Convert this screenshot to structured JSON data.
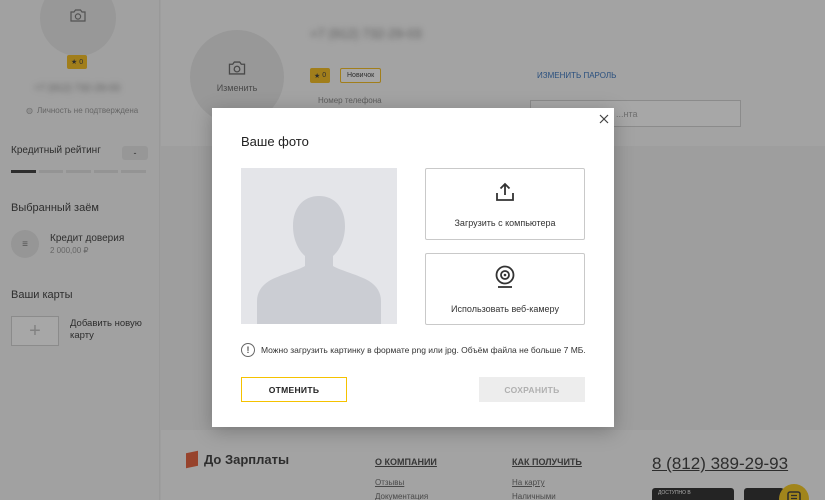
{
  "sidebar": {
    "rating_badge": "0",
    "phone_blurred": "+7 (912) 732-29-03",
    "verification_text": "Личность не подтверждена",
    "credit_rating_title": "Кредитный рейтинг",
    "credit_rating_value": "-",
    "selected_loan_title": "Выбранный заём",
    "loan_name": "Кредит доверия",
    "loan_amount": "2 000,00 ₽",
    "cards_title": "Ваши карты",
    "add_card_label": "Добавить новую карту"
  },
  "profile": {
    "phone_blurred": "+7 (912) 732-29-03",
    "change_photo": "Изменить",
    "rating_badge": "0",
    "status_badge": "Новичок",
    "change_password": "ИЗМЕНИТЬ ПАРОЛЬ",
    "phone_field_label": "Номер телефона",
    "field_placeholder": "...нта"
  },
  "modal": {
    "title": "Ваше фото",
    "upload_label": "Загрузить с компьютера",
    "webcam_label": "Использовать веб-камеру",
    "hint": "Можно загрузить картинку в формате png или jpg. Объём файла не больше 7 МБ.",
    "cancel": "ОТМЕНИТЬ",
    "save": "СОХРАНИТЬ"
  },
  "footer": {
    "brand": "До Зарплаты",
    "col1_title": "О КОМПАНИИ",
    "col1_links": [
      "Отзывы",
      "Документация"
    ],
    "col2_title": "КАК ПОЛУЧИТЬ",
    "col2_links": [
      "На карту",
      "Наличными"
    ],
    "phone": "8 (812) 389-29-93",
    "store_badge": "ДОСТУПНО В"
  },
  "colors": {
    "accent": "#f5c200",
    "link": "#1a5fb4",
    "overlay": "#3c3c3c"
  }
}
